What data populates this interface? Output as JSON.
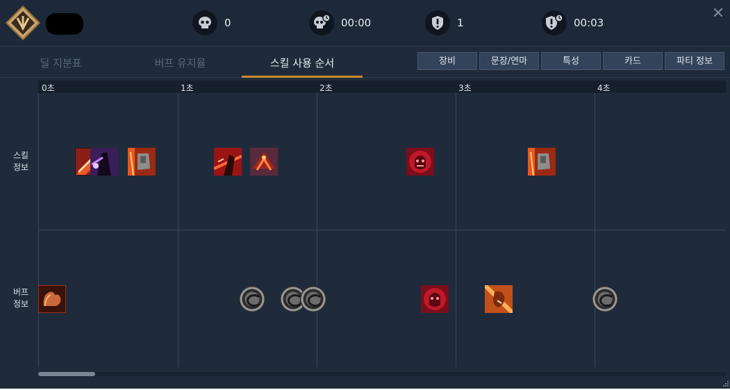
{
  "header": {
    "stats": [
      {
        "icon": "skull-icon",
        "value": "0"
      },
      {
        "icon": "skull-clock-icon",
        "value": "00:00"
      },
      {
        "icon": "shield-alert-icon",
        "value": "1"
      },
      {
        "icon": "shield-clock-icon",
        "value": "00:03"
      }
    ],
    "close_label": "✕"
  },
  "tabs": [
    "딜 지분표",
    "버프 유지율",
    "스킬 사용 순서"
  ],
  "active_tab": 2,
  "buttons": [
    "장비",
    "문장/연마",
    "특성",
    "카드",
    "파티 정보"
  ],
  "timeline": {
    "ticks": [
      "0초",
      "1초",
      "2초",
      "3초",
      "4초"
    ],
    "rows": [
      {
        "label_line1": "스킬",
        "label_line2": "정보"
      },
      {
        "label_line1": "버프",
        "label_line2": "정보"
      }
    ],
    "skill_icons": [
      "slash-skill-icon",
      "shadow-skill-icon",
      "fist-skill-icon",
      "blade-skill-icon",
      "dragon-skill-icon",
      "rage-skill-icon",
      "fist-skill-icon"
    ],
    "buff_icons": [
      "strength-buff-icon",
      "ring-buff-icon",
      "ring-buff-icon",
      "ring-buff-icon",
      "rage-buff-icon",
      "shout-buff-icon",
      "ring-buff-icon"
    ]
  },
  "colors": {
    "accent": "#c98a2c",
    "background": "#1f2b3b"
  }
}
